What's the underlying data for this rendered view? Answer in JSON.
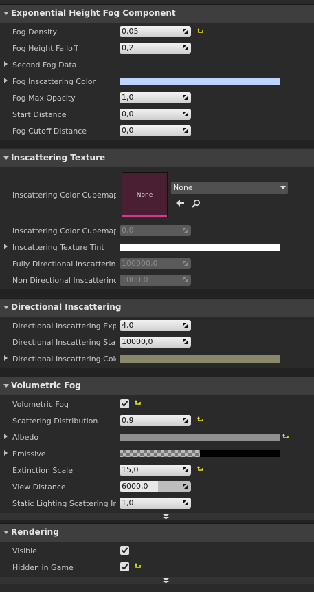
{
  "sections": {
    "fog": "Exponential Height Fog Component",
    "tex": "Inscattering Texture",
    "dir": "Directional Inscattering",
    "vol": "Volumetric Fog",
    "rend": "Rendering"
  },
  "fog": {
    "density_label": "Fog Density",
    "density": "0,05",
    "falloff_label": "Fog Height Falloff",
    "falloff": "0,2",
    "second_label": "Second Fog Data",
    "inscatter_label": "Fog Inscattering Color",
    "max_op_label": "Fog Max Opacity",
    "max_op": "1,0",
    "start_label": "Start Distance",
    "start": "0,0",
    "cutoff_label": "Fog Cutoff Distance",
    "cutoff": "0,0"
  },
  "tex": {
    "cubemap_label": "Inscattering Color Cubemap",
    "cubemap_thumb": "None",
    "cubemap_value": "None",
    "angle_label": "Inscattering Color Cubemap Ar",
    "angle": "0,0",
    "tint_label": "Inscattering Texture Tint",
    "full_label": "Fully Directional Inscattering C",
    "full": "100000,0",
    "non_label": "Non Directional Inscattering Co",
    "non": "1000,0"
  },
  "dir": {
    "exp_label": "Directional Inscattering Expone",
    "exp": "4,0",
    "start_label": "Directional Inscattering Start D",
    "start": "10000,0",
    "color_label": "Directional Inscattering Color"
  },
  "vol": {
    "fog_label": "Volumetric Fog",
    "scatter_label": "Scattering Distribution",
    "scatter": "0,9",
    "albedo_label": "Albedo",
    "emissive_label": "Emissive",
    "ext_label": "Extinction Scale",
    "ext": "15,0",
    "view_label": "View Distance",
    "view": "6000,0",
    "static_label": "Static Lighting Scattering Inter",
    "static": "1,0"
  },
  "rend": {
    "visible_label": "Visible",
    "hidden_label": "Hidden in Game"
  },
  "colors": {
    "inscatter": "#bcd4ff",
    "tint": "#ffffff",
    "dir_color": "#8a8a6a",
    "albedo": "#8f8f8f",
    "accent_reset": "#e8e020"
  }
}
